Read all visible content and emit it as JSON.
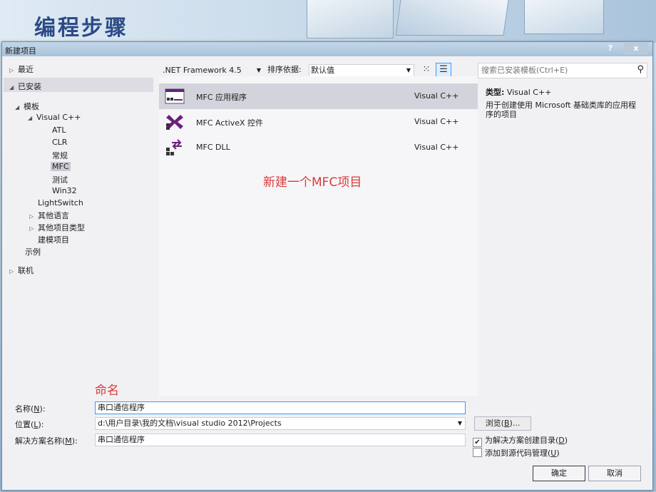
{
  "slide": {
    "title": "编程步骤"
  },
  "dialog": {
    "title": "新建项目",
    "help_btn": "?",
    "close_btn": "x"
  },
  "tree": {
    "recent": "最近",
    "installed": "已安装",
    "templates": "模板",
    "vcpp": "Visual C++",
    "atl": "ATL",
    "clr": "CLR",
    "general": "常规",
    "mfc": "MFC",
    "test": "测试",
    "win32": "Win32",
    "lightswitch": "LightSwitch",
    "other_languages": "其他语言",
    "other_project_types": "其他项目类型",
    "modeling_projects": "建模项目",
    "samples": "示例",
    "online": "联机"
  },
  "toolbar": {
    "framework": ".NET Framework 4.5",
    "sort_label": "排序依据:",
    "sort_value": "默认值"
  },
  "search": {
    "placeholder": "搜索已安装模板(Ctrl+E)"
  },
  "templates": [
    {
      "name": "MFC 应用程序",
      "lang": "Visual C++"
    },
    {
      "name": "MFC ActiveX 控件",
      "lang": "Visual C++"
    },
    {
      "name": "MFC DLL",
      "lang": "Visual C++"
    }
  ],
  "annotations": {
    "new_project": "新建一个MFC项目",
    "naming": "命名"
  },
  "details": {
    "type_label": "类型:",
    "type_value": "Visual C++",
    "description": "用于创建使用 Microsoft 基础类库的应用程序的项目"
  },
  "form": {
    "name_label_pre": "名称(",
    "name_key": "N",
    "name_label_post": "):",
    "name_value": "串口通信程序",
    "location_label_pre": "位置(",
    "location_key": "L",
    "location_label_post": "):",
    "location_value": "d:\\用户目录\\我的文档\\visual studio 2012\\Projects",
    "solution_label_pre": "解决方案名称(",
    "solution_key": "M",
    "solution_label_post": "):",
    "solution_value": "串口通信程序",
    "browse_pre": "浏览(",
    "browse_key": "B",
    "browse_post": ")...",
    "create_dir_pre": "为解决方案创建目录(",
    "create_dir_key": "D",
    "create_dir_post": ")",
    "create_dir_checked": true,
    "source_control_pre": "添加到源代码管理(",
    "source_control_key": "U",
    "source_control_post": ")",
    "source_control_checked": false,
    "ok": "确定",
    "cancel": "取消"
  },
  "colors": {
    "annotation": "#d93a3a",
    "accent": "#3399ff",
    "mfc_purple": "#68217a"
  }
}
